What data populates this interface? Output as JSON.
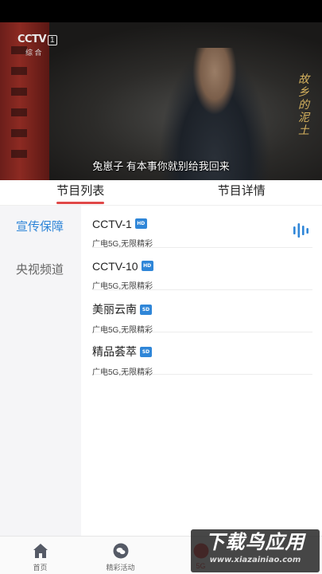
{
  "player": {
    "logo_text": "CCTV",
    "logo_number": "1",
    "logo_sub": "综 合",
    "show_title": "故乡的泥土",
    "subtitle": "兔崽子  有本事你就别给我回来"
  },
  "tabs": [
    {
      "label": "节目列表",
      "active": true
    },
    {
      "label": "节目详情",
      "active": false
    }
  ],
  "sidebar": {
    "items": [
      {
        "label": "宣传保障",
        "active": true
      },
      {
        "label": "央视频道",
        "active": false
      }
    ]
  },
  "channels": [
    {
      "name": "CCTV-1",
      "quality": "HD",
      "desc": "广电5G,无限精彩",
      "playing": true
    },
    {
      "name": "CCTV-10",
      "quality": "HD",
      "desc": "广电5G,无限精彩",
      "playing": false
    },
    {
      "name": "美丽云南",
      "quality": "SD",
      "desc": "广电5G,无限精彩",
      "playing": false
    },
    {
      "name": "精品荟萃",
      "quality": "SD",
      "desc": "广电5G,无限精彩",
      "playing": false
    }
  ],
  "bottom_nav": [
    {
      "label": "首页",
      "icon": "home-icon"
    },
    {
      "label": "精彩活动",
      "icon": "chat-bubble-icon"
    },
    {
      "label": "5G",
      "icon": "5g-icon"
    },
    {
      "label": "",
      "icon": ""
    }
  ],
  "watermark": {
    "main": "下载鸟应用",
    "url": "www.xiazainiao.com"
  },
  "colors": {
    "accent_blue": "#2f86d8",
    "tab_indicator_red": "#e04848"
  }
}
